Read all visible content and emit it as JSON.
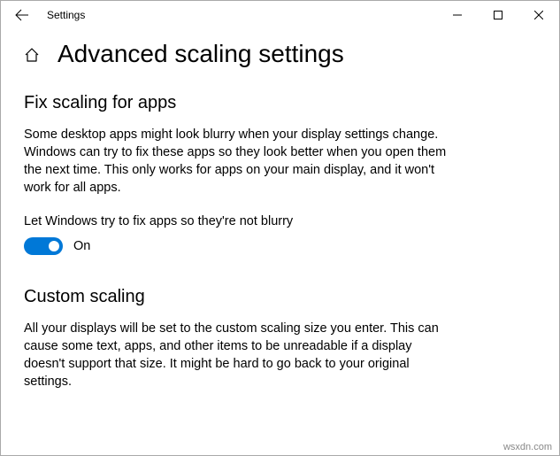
{
  "titlebar": {
    "title": "Settings"
  },
  "header": {
    "page_title": "Advanced scaling settings"
  },
  "sections": {
    "fix_scaling": {
      "heading": "Fix scaling for apps",
      "description": "Some desktop apps might look blurry when your display settings change. Windows can try to fix these apps so they look better when you open them the next time. This only works for apps on your main display, and it won't work for all apps.",
      "toggle_label": "Let Windows try to fix apps so they're not blurry",
      "toggle_state": "On"
    },
    "custom_scaling": {
      "heading": "Custom scaling",
      "description": "All your displays will be set to the custom scaling size you enter. This can cause some text, apps, and other items to be unreadable if a display doesn't support that size. It might be hard to go back to your original settings."
    }
  },
  "footer": {
    "watermark": "wsxdn.com"
  }
}
